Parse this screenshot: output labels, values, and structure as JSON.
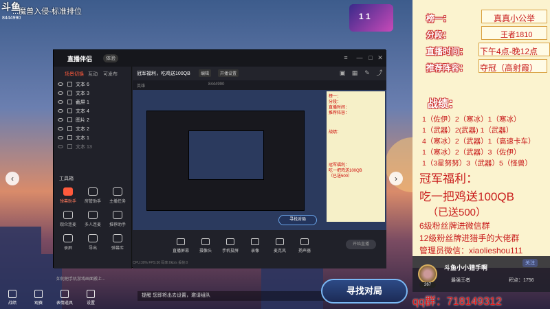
{
  "stream": {
    "logo": "斗鱼",
    "title": "...魔兽入侵-标准排位",
    "room_id": "8444990"
  },
  "match_badge": "1 1",
  "obs": {
    "app_name": "直播伴侣",
    "version": "体验",
    "tabs": [
      "场景切换",
      "互动",
      "可发布"
    ],
    "sources": [
      "文本 6",
      "文本 3",
      "截屏 1",
      "文本 4",
      "图片 2",
      "文本 2",
      "文本 1",
      "文本 13"
    ],
    "tools_title": "工具箱",
    "tools": [
      {
        "label": "弹幕助手",
        "hot": true
      },
      {
        "label": "房管助手",
        "hot": false
      },
      {
        "label": "主播任务",
        "hot": false
      },
      {
        "label": "观众连麦",
        "hot": false
      },
      {
        "label": "多人连麦",
        "hot": false
      },
      {
        "label": "推荐助手",
        "hot": false
      },
      {
        "label": "录屏",
        "hot": false
      },
      {
        "label": "导出",
        "hot": false
      },
      {
        "label": "弹幕库",
        "hot": false
      }
    ],
    "tip": "如何把手机游戏画面搬上...",
    "stream_name": "冠军福利，吃鸡送100QB",
    "category": "英雄",
    "room_label": "8444990",
    "toolbar_chips": [
      "编辑",
      "开播设置"
    ],
    "find_match_small": "寻找对局",
    "bottom_tools": [
      "直播屏幕",
      "摄像头",
      "手机投屏",
      "录像",
      "麦克风",
      "扬声器"
    ],
    "start_live": "开始直播",
    "stats": "CPU:30%  FPS:30  码率:0kb/s  丢帧:0"
  },
  "info": {
    "rank_label": "榜一：",
    "rank_value": "真真小公举",
    "tier_label": "分段：",
    "tier_value": "王者1810",
    "time_label": "直播时间：",
    "time_value": "下午4点-晚12点",
    "lineup_label": "推荐阵容：",
    "lineup_value": "夺冠（高射霞）",
    "record_title": "战绩：",
    "records": [
      "1（佐伊）2（寒冰）1（寒冰）",
      "1（武器）2(武器) 1（武器）",
      "4（寒冰）2（武器）1（高速卡车）",
      "1（寒冰）2（武器）3（佐伊）",
      "1（3星努努）3（武器）5（怪兽）"
    ],
    "prize_title": "冠军福利：",
    "prize_line": "吃一把鸡送100QB",
    "prize_sent": "（已送500）",
    "fan_lines": [
      "6级粉丝牌进微信群",
      "12级粉丝牌进猎手的大佬群",
      "管理员微信：xiaolieshou111"
    ]
  },
  "profile": {
    "follow": "关注",
    "level": "267",
    "name": "斗鱼小小猎手啊",
    "rank": "最强王者",
    "score_label": "积点：",
    "score": "1756"
  },
  "qq_group": "qq群：718149312",
  "game_bottom": [
    "战绩",
    "观赛",
    "表情道具",
    "设置"
  ],
  "chat_hint": "提醒  您即将出去设置，邀请组队",
  "find_match_big": "寻找对局"
}
